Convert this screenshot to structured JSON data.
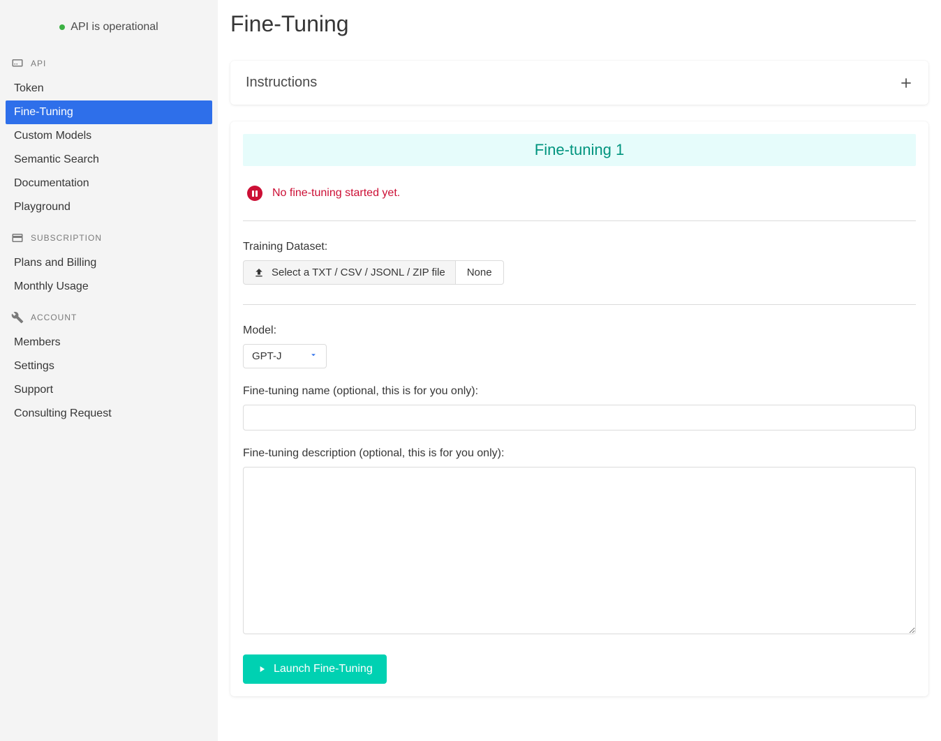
{
  "sidebar": {
    "status": "API is operational",
    "sections": {
      "api": {
        "header": "API",
        "items": [
          "Token",
          "Fine-Tuning",
          "Custom Models",
          "Semantic Search",
          "Documentation",
          "Playground"
        ]
      },
      "subscription": {
        "header": "Subscription",
        "items": [
          "Plans and Billing",
          "Monthly Usage"
        ]
      },
      "account": {
        "header": "Account",
        "items": [
          "Members",
          "Settings",
          "Support",
          "Consulting Request"
        ]
      }
    },
    "active_item": "Fine-Tuning"
  },
  "page": {
    "title": "Fine-Tuning",
    "instructions_title": "Instructions"
  },
  "finetune": {
    "banner": "Fine-tuning 1",
    "status_message": "No fine-tuning started yet.",
    "training_label": "Training Dataset:",
    "upload_button": "Select a TXT / CSV / JSONL / ZIP file",
    "upload_filename": "None",
    "model_label": "Model:",
    "model_selected": "GPT-J",
    "name_label": "Fine-tuning name (optional, this is for you only):",
    "name_value": "",
    "description_label": "Fine-tuning description (optional, this is for you only):",
    "description_value": "",
    "launch_button": "Launch Fine-Tuning"
  }
}
